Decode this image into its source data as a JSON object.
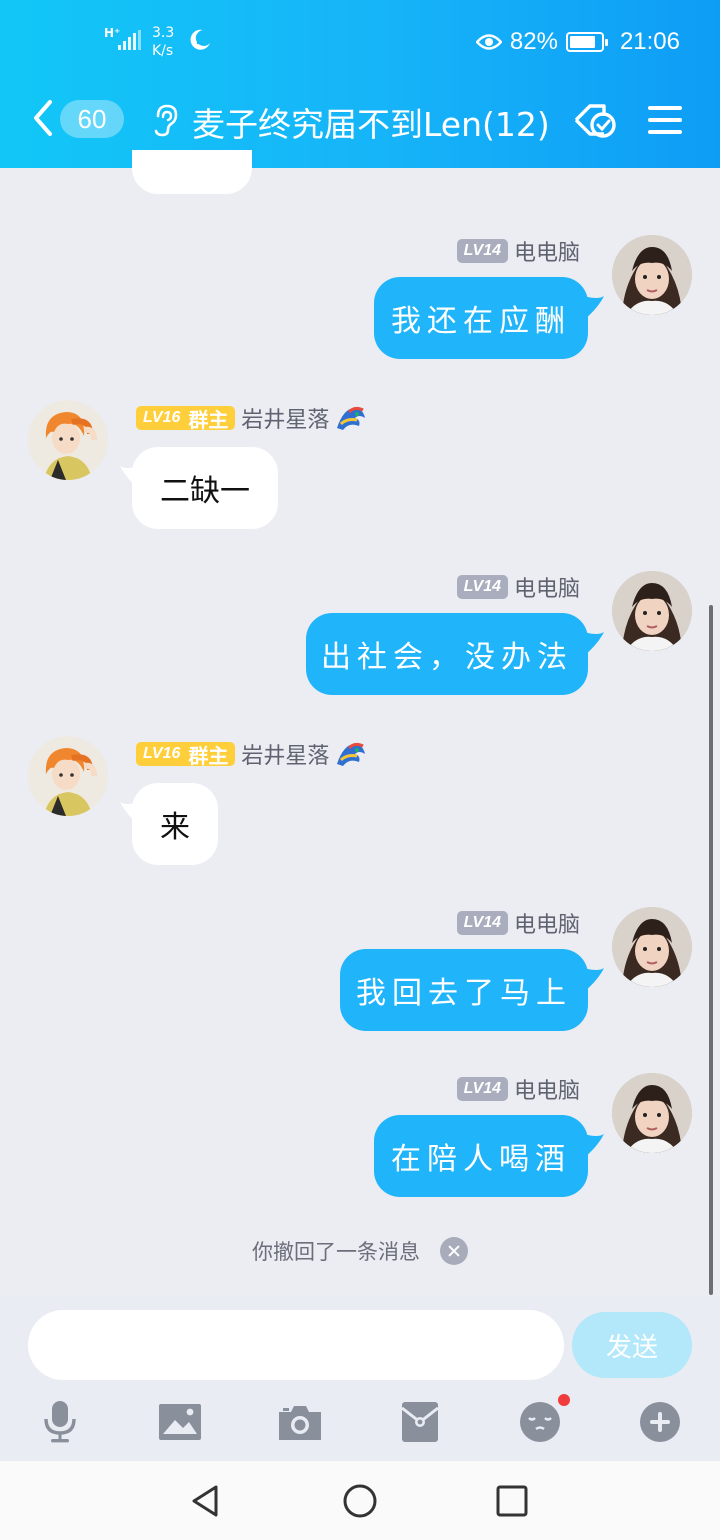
{
  "status_bar": {
    "network": "H⁺",
    "speed_value": "3.3",
    "speed_unit": "K/s",
    "battery": "82%",
    "battery_level": 0.82,
    "time": "21:06",
    "icons": [
      "signal-icon",
      "moon-icon",
      "eye-icon",
      "battery-icon"
    ]
  },
  "header": {
    "unread_count": "60",
    "title": "麦子终究届不到Len(12)",
    "icons": [
      "back-icon",
      "ear-icon",
      "sync-icon",
      "menu-icon"
    ]
  },
  "messages": [
    {
      "sender": "me",
      "level": "LV14",
      "name": "电电脑",
      "text": "我还在应酬"
    },
    {
      "sender": "other",
      "level": "LV16",
      "role": "群主",
      "name": "岩井星落",
      "text": "二缺一"
    },
    {
      "sender": "me",
      "level": "LV14",
      "name": "电电脑",
      "text": "出社会，没办法"
    },
    {
      "sender": "other",
      "level": "LV16",
      "role": "群主",
      "name": "岩井星落",
      "text": "来"
    },
    {
      "sender": "me",
      "level": "LV14",
      "name": "电电脑",
      "text": "我回去了马上"
    },
    {
      "sender": "me",
      "level": "LV14",
      "name": "电电脑",
      "text": "在陪人喝酒"
    }
  ],
  "system_notice": "你撤回了一条消息",
  "input": {
    "value": "",
    "send_label": "发送"
  },
  "toolbar": [
    "microphone-icon",
    "image-icon",
    "camera-icon",
    "red-packet-icon",
    "emoji-icon",
    "plus-icon"
  ],
  "colors": {
    "accent": "#20b4fb",
    "header": "#16b3f8",
    "background": "#ebedf3"
  }
}
